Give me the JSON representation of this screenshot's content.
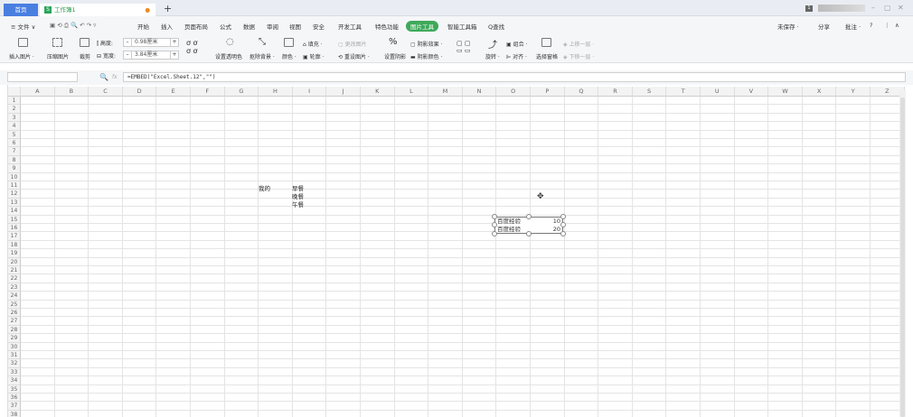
{
  "tabs": {
    "home": "首页",
    "doc": "工作簿1",
    "doc_icon": "S",
    "new_tab": "+",
    "account_badge": "1"
  },
  "window": {
    "minimize": "–",
    "restore": "▢",
    "close": "✕"
  },
  "menu": {
    "file": "≡ 文件 ∨",
    "items": [
      "开始",
      "插入",
      "页面布局",
      "公式",
      "数据",
      "审阅",
      "视图",
      "安全",
      "开发工具",
      "特色功能",
      "图片工具",
      "智能工具箱"
    ],
    "active": "图片工具",
    "search": "Q查找",
    "unsaved": "未保存 ·",
    "share": "分享",
    "comment": "批注 ·",
    "help": "?",
    "more": "⋮",
    "collapse": "∧"
  },
  "ribbon": {
    "insert_picture": "插入图片 ·",
    "compress": "压缩图片",
    "crop": "裁剪",
    "height_label": "高度:",
    "height_value": "0.98厘米",
    "width_label": "宽度:",
    "width_value": "3.84厘米",
    "transparent": "设置透明色",
    "remove_bg": "抠除背景 ·",
    "color": "颜色 ·",
    "fill": "填充 ·",
    "outline": "轮廓 ·",
    "change_pic": "更改图片",
    "reset_pic": "重设图片 ·",
    "shadow": "设置阴影",
    "shadow_effect": "阴影效果 ·",
    "shadow_color": "阴影颜色 ·",
    "rotate": "旋转 ·",
    "group": "组合 ·",
    "align": "对齐 ·",
    "select_pane": "选择窗格",
    "bring_forward": "上移一层 ·",
    "send_backward": "下移一层 ·"
  },
  "formula_bar": {
    "name_box": "",
    "fx": "fx",
    "formula": "=EMBED(\"Excel.Sheet.12\",\"\")"
  },
  "sheet": {
    "columns": [
      "A",
      "B",
      "C",
      "D",
      "E",
      "F",
      "G",
      "H",
      "I",
      "J",
      "K",
      "L",
      "M",
      "N",
      "O",
      "P",
      "Q",
      "R",
      "S",
      "T",
      "U",
      "V",
      "W",
      "X",
      "Y",
      "Z"
    ],
    "row_count": 38,
    "cells": {
      "h11": "我的",
      "i11": "早餐",
      "i12": "晚餐",
      "i13": "午餐"
    }
  },
  "embedded": {
    "rows": [
      {
        "label": "百度经验",
        "value": "10"
      },
      {
        "label": "百度经验",
        "value": "20"
      }
    ]
  },
  "colors": {
    "accent": "#3ea95a",
    "home_tab": "#4a7fe0"
  }
}
